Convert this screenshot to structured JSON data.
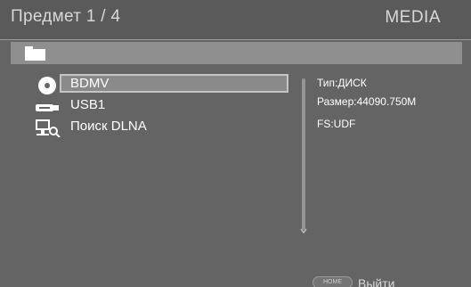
{
  "header": {
    "title": "Предмет 1 / 4",
    "mode": "MEDIA"
  },
  "path_bar": {
    "icon": "folder-icon"
  },
  "items": [
    {
      "label": "BDMV",
      "icon": "disc-icon",
      "selected": true
    },
    {
      "label": "USB1",
      "icon": "usb-icon",
      "selected": false
    },
    {
      "label": "Поиск DLNA",
      "icon": "dlna-search-icon",
      "selected": false
    }
  ],
  "info": {
    "type": "Тип:ДИСК",
    "size": "Размер:44090.750M",
    "fs": "FS:UDF"
  },
  "footer": {
    "home_key": "HOME",
    "exit_label": "Выйти"
  },
  "colors": {
    "background": "#646464",
    "header": "#5a5a5a",
    "path_bar": "#8f8f8f",
    "selection": "#8a8a8a"
  }
}
